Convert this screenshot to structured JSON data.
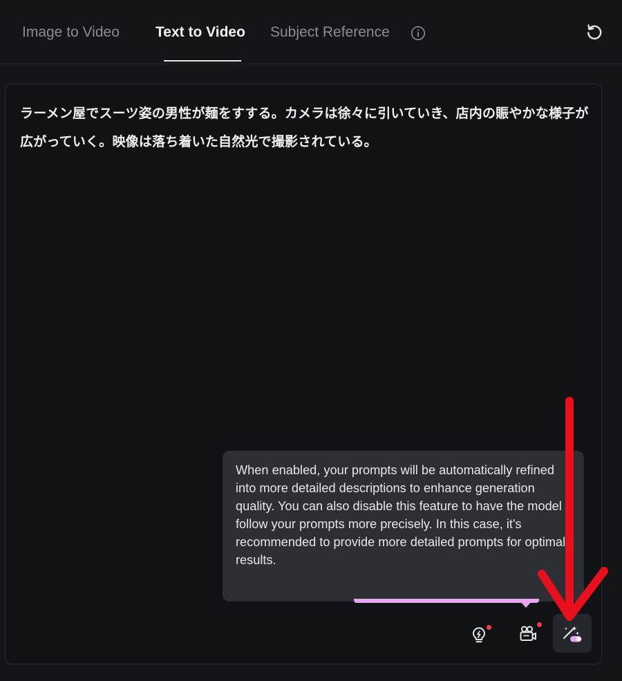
{
  "tabs": [
    {
      "label": "Image to Video",
      "active": false
    },
    {
      "label": "Text to Video",
      "active": true
    },
    {
      "label": "Subject Reference",
      "active": false
    }
  ],
  "icons": {
    "info": "info-icon",
    "reset": "refresh-icon",
    "idea": "lightbulb-icon",
    "camera": "movie-camera-icon",
    "enhance": "magic-wand-toggle-icon"
  },
  "prompt": {
    "text": "ラーメン屋でスーツ姿の男性が麺をすする。カメラは徐々に引いていき、店内の賑やかな様子が広がっていく。映像は落ち着いた自然光で撮影されている。"
  },
  "tooltip": {
    "text": "When enabled, your prompts will be automatically refined into more detailed descriptions to enhance generation quality. You can also disable this feature to have the model follow your prompts more precisely. In this case, it's recommended to provide more detailed prompts for optimal results."
  },
  "colors": {
    "accent": "#e5a8ee",
    "annotation": "#e8101c",
    "notification_dot": "#ff3b44"
  }
}
